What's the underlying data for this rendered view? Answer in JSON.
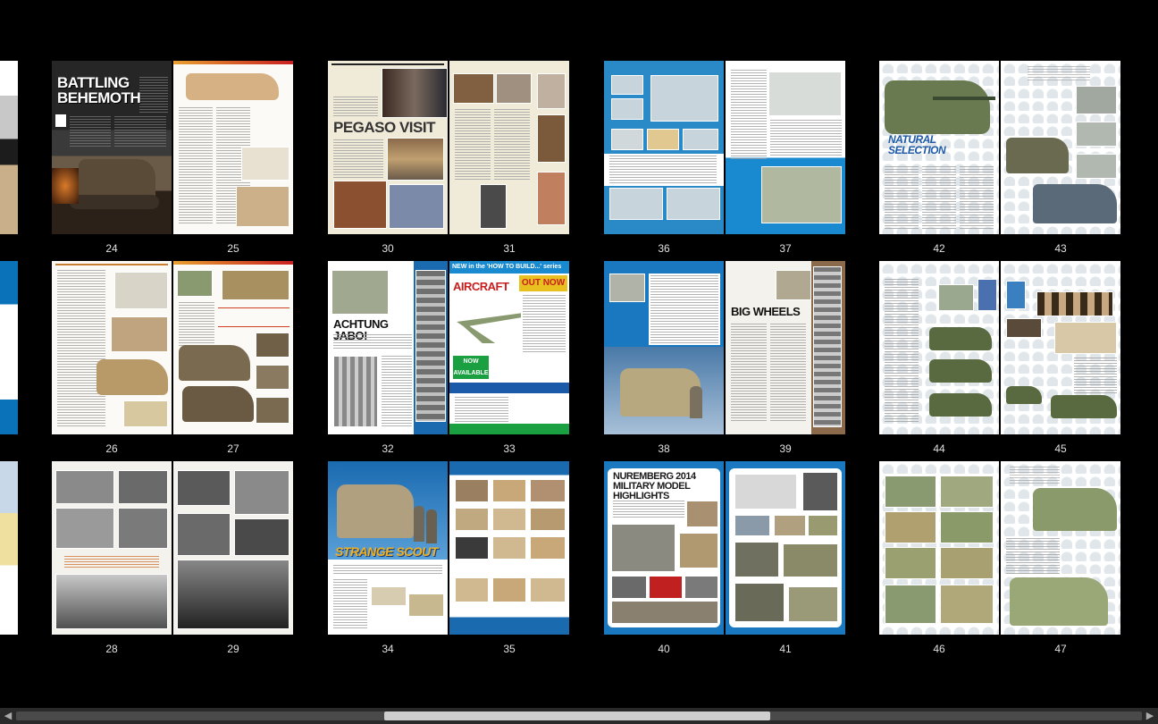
{
  "viewer": {
    "rows": [
      {
        "spreads": [
          {
            "left_page": "24",
            "right_page": "25",
            "left_headline": "BATTLING BEHEMOTH",
            "right_headline": ""
          },
          {
            "left_page": "30",
            "right_page": "31",
            "left_headline": "PEGASO VISIT",
            "right_headline": ""
          },
          {
            "left_page": "36",
            "right_page": "37",
            "left_headline": "",
            "right_headline": ""
          },
          {
            "left_page": "42",
            "right_page": "43",
            "left_headline": "NATURAL SELECTION",
            "right_headline": ""
          }
        ]
      },
      {
        "spreads": [
          {
            "left_page": "26",
            "right_page": "27",
            "left_headline": "",
            "right_headline": ""
          },
          {
            "left_page": "32",
            "right_page": "33",
            "left_headline": "ACHTUNG JABO!",
            "right_headline": "AIRCRAFT",
            "right_banner": "NEW in the 'HOW TO BUILD...' series",
            "right_badge": "OUT NOW",
            "right_badge2": "NOW AVAILABLE"
          },
          {
            "left_page": "38",
            "right_page": "39",
            "left_headline": "",
            "right_headline": "BIG WHEELS"
          },
          {
            "left_page": "44",
            "right_page": "45",
            "left_headline": "",
            "right_headline": ""
          }
        ]
      },
      {
        "spreads": [
          {
            "left_page": "28",
            "right_page": "29",
            "left_headline": "",
            "right_headline": ""
          },
          {
            "left_page": "34",
            "right_page": "35",
            "left_headline": "STRANGE SCOUT",
            "right_headline": ""
          },
          {
            "left_page": "40",
            "right_page": "41",
            "left_headline": "NUREMBERG 2014 MILITARY MODEL HIGHLIGHTS",
            "right_headline": ""
          },
          {
            "left_page": "46",
            "right_page": "47",
            "left_headline": "",
            "right_headline": ""
          }
        ]
      }
    ]
  },
  "scrollbar": {
    "left_arrow": "◀",
    "right_arrow": "▶",
    "position_fraction": 0.33
  }
}
